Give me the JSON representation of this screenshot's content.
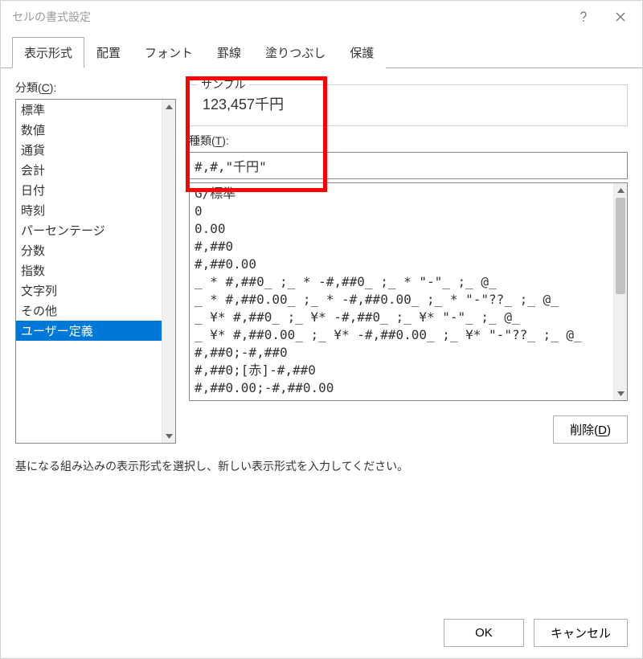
{
  "dialog_title": "セルの書式設定",
  "tabs": [
    "表示形式",
    "配置",
    "フォント",
    "罫線",
    "塗りつぶし",
    "保護"
  ],
  "active_tab_index": 0,
  "category_label_prefix": "分類(",
  "category_label_accel": "C",
  "category_label_suffix": "):",
  "categories": [
    "標準",
    "数値",
    "通貨",
    "会計",
    "日付",
    "時刻",
    "パーセンテージ",
    "分数",
    "指数",
    "文字列",
    "その他",
    "ユーザー定義"
  ],
  "selected_category_index": 11,
  "sample_label": "サンプル",
  "sample_value": "123,457千円",
  "type_label_prefix": "種類(",
  "type_label_accel": "T",
  "type_label_suffix": "):",
  "type_value": "#,#,\"千円\"",
  "patterns": [
    "G/標準",
    "0",
    "0.00",
    "#,##0",
    "#,##0.00",
    "_ * #,##0_ ;_ * -#,##0_ ;_ * \"-\"_ ;_ @_",
    "_ * #,##0.00_ ;_ * -#,##0.00_ ;_ * \"-\"??_ ;_ @_",
    "_ ¥* #,##0_ ;_ ¥* -#,##0_ ;_ ¥* \"-\"_ ;_ @_",
    "_ ¥* #,##0.00_ ;_ ¥* -#,##0.00_ ;_ ¥* \"-\"??_ ;_ @_",
    "#,##0;-#,##0",
    "#,##0;[赤]-#,##0",
    "#,##0.00;-#,##0.00"
  ],
  "delete_prefix": "削除(",
  "delete_accel": "D",
  "delete_suffix": ")",
  "help_text": "基になる組み込みの表示形式を選択し、新しい表示形式を入力してください。",
  "ok_label": "OK",
  "cancel_label": "キャンセル",
  "colors": {
    "selection_bg": "#0078d7",
    "highlight_border": "#ff0000"
  }
}
